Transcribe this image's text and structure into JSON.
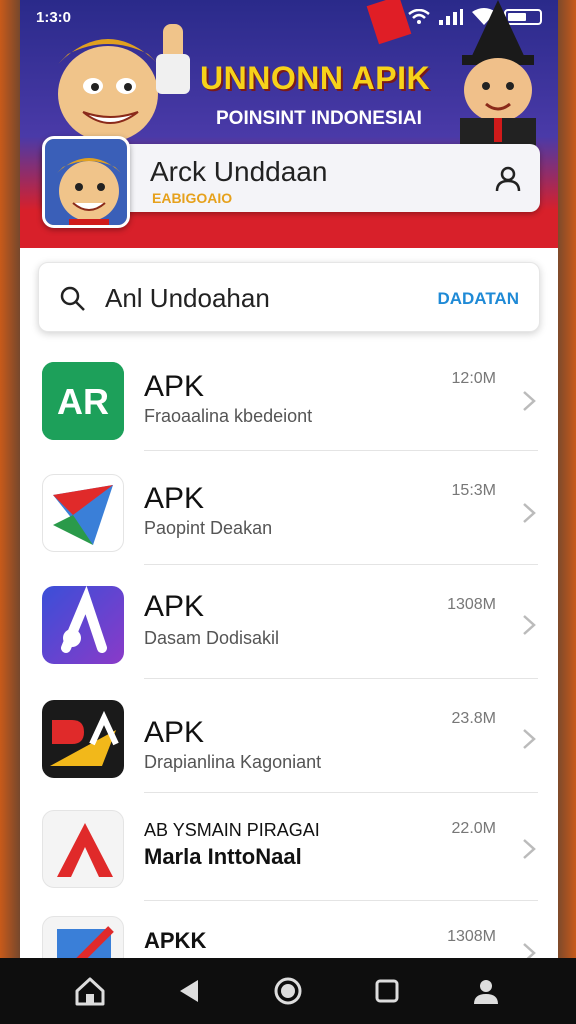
{
  "status": {
    "time": "1:3:0"
  },
  "banner": {
    "title": "UNNONN APIK",
    "subtitle": "POINSINT INDONESIAI",
    "badge_icon": "shield-icon"
  },
  "app_card": {
    "title": "Arck Unddaan",
    "subtitle": "EABIGOAIO"
  },
  "search": {
    "value": "Anl Undoahan",
    "action_label": "DADATAN"
  },
  "items": [
    {
      "title": "APK",
      "subtitle": "Fraoaalina kbedeiont",
      "size": "12:0M",
      "icon_text": "AR",
      "icon_color": "#1da05a"
    },
    {
      "title": "APK",
      "subtitle": "Paopint Deakan",
      "size": "15:3M",
      "icon_text": "",
      "icon_color": "#ffffff"
    },
    {
      "title": "APK",
      "subtitle": "Dasam Dodisakil",
      "size": "1308M",
      "icon_text": "",
      "icon_color": "#3a4fd8"
    },
    {
      "title": "APK",
      "subtitle": "Drapianlina Kagoniant",
      "size": "23.8M",
      "icon_text": "",
      "icon_color": "#1a1a1a"
    },
    {
      "title": "AB YSMAIN PIRAGAI",
      "subtitle": "Marla InttoNaal",
      "size": "22.0M",
      "icon_text": "",
      "icon_color": "#f4f4f4"
    },
    {
      "title": "APKK",
      "subtitle": "",
      "size": "1308M",
      "icon_text": "",
      "icon_color": "#f4f4f4"
    }
  ],
  "nav": [
    "home-icon",
    "back-icon",
    "circle-home-icon",
    "recents-icon",
    "user-icon"
  ]
}
